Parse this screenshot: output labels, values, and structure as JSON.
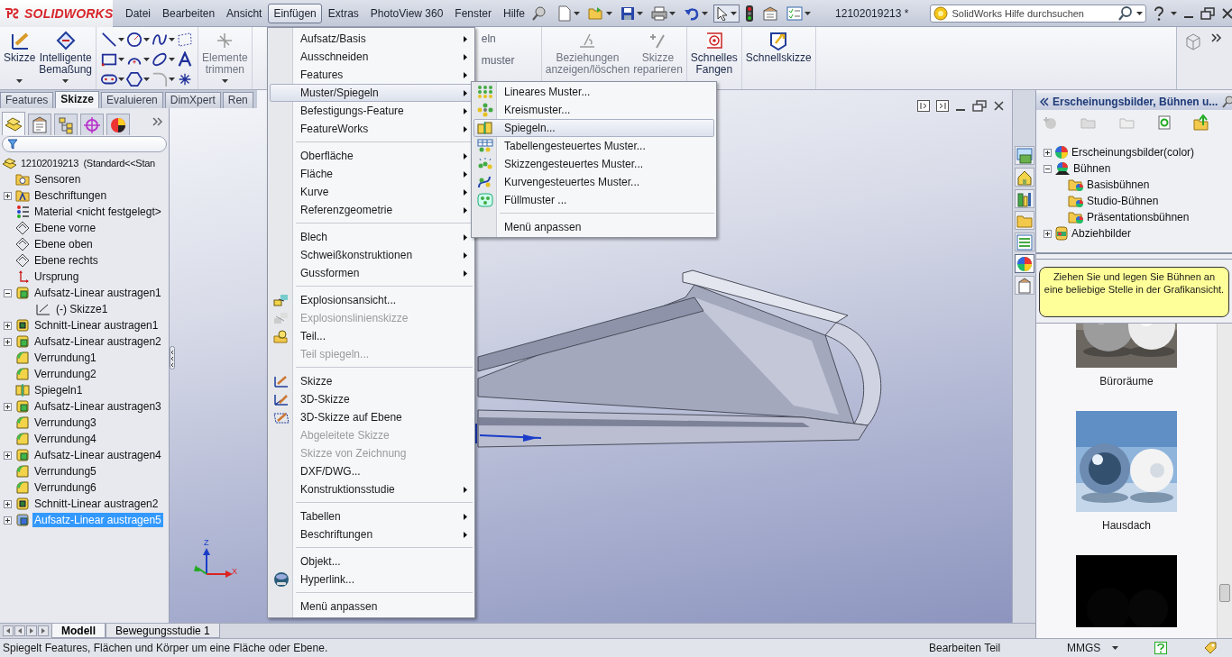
{
  "app_logo": "SOLIDWORKS",
  "menu_bar": [
    {
      "label": "Datei",
      "selected": false
    },
    {
      "label": "Bearbeiten",
      "selected": false
    },
    {
      "label": "Ansicht",
      "selected": false
    },
    {
      "label": "Einfügen",
      "selected": true
    },
    {
      "label": "Extras",
      "selected": false
    },
    {
      "label": "PhotoView 360",
      "selected": false
    },
    {
      "label": "Fenster",
      "selected": false
    },
    {
      "label": "Hilfe",
      "selected": false
    }
  ],
  "document_title": "12102019213 *",
  "help_search": {
    "placeholder": "SolidWorks Hilfe durchsuchen"
  },
  "ribbon": {
    "groups": [
      {
        "kind": "buttons",
        "buttons": [
          {
            "label": "Skizze",
            "disabled": false,
            "dropdown": true
          },
          {
            "label": "Intelligente Bemaßung",
            "disabled": false,
            "dropdown": true
          }
        ]
      },
      {
        "kind": "tools",
        "tools": [
          {
            "kind": "line",
            "disabled": false
          },
          {
            "kind": "circle",
            "disabled": false
          },
          {
            "kind": "spline",
            "disabled": false
          },
          {
            "kind": "construction",
            "disabled": false
          },
          {
            "kind": "rectangle",
            "disabled": false
          },
          {
            "kind": "arc",
            "disabled": false
          },
          {
            "kind": "ellipse",
            "disabled": false
          },
          {
            "kind": "text",
            "disabled": false
          },
          {
            "kind": "slot",
            "disabled": false
          },
          {
            "kind": "polygon",
            "disabled": false
          },
          {
            "kind": "fillet",
            "disabled": true
          },
          {
            "kind": "point",
            "disabled": false
          }
        ]
      },
      {
        "kind": "buttons",
        "buttons": [
          {
            "label": "Elemente trimmen",
            "disabled": true,
            "dropdown": true
          }
        ]
      },
      {
        "kind": "covered",
        "labels": [
          "eln",
          "muster"
        ]
      },
      {
        "kind": "buttons",
        "buttons": [
          {
            "label": "Beziehungen anzeigen/löschen",
            "disabled": true,
            "dropdown": false
          },
          {
            "label": "Skizze reparieren",
            "disabled": true,
            "dropdown": false
          }
        ]
      },
      {
        "kind": "buttons",
        "buttons": [
          {
            "label": "Schnelles Fangen",
            "disabled": false,
            "dropdown": false
          }
        ]
      },
      {
        "kind": "buttons",
        "buttons": [
          {
            "label": "Schnellskizze",
            "disabled": false,
            "dropdown": false
          }
        ]
      }
    ]
  },
  "command_tabs": [
    {
      "label": "Features",
      "selected": false
    },
    {
      "label": "Skizze",
      "selected": true
    },
    {
      "label": "Evaluieren",
      "selected": false
    },
    {
      "label": "DimXpert",
      "selected": false
    },
    {
      "label": "Ren",
      "selected": false
    }
  ],
  "panel_tabs": [
    {
      "kind": "feature_tree",
      "selected": true
    },
    {
      "kind": "properties",
      "selected": false
    },
    {
      "kind": "configurations",
      "selected": false
    },
    {
      "kind": "dimxpert",
      "selected": false
    },
    {
      "kind": "display",
      "selected": false
    }
  ],
  "feature_tree": {
    "root": "12102019213  (Standard<<Stan",
    "items": [
      {
        "label": "Sensoren",
        "kind": "sensors",
        "selected": false
      },
      {
        "label": "Beschriftungen",
        "kind": "annotations",
        "expanded": false,
        "selected": false
      },
      {
        "label": "Material <nicht festgelegt>",
        "kind": "material",
        "selected": false
      },
      {
        "label": "Ebene vorne",
        "kind": "plane",
        "selected": false
      },
      {
        "label": "Ebene oben",
        "kind": "plane",
        "selected": false
      },
      {
        "label": "Ebene rechts",
        "kind": "plane",
        "selected": false
      },
      {
        "label": "Ursprung",
        "kind": "origin",
        "selected": false
      },
      {
        "label": "Aufsatz-Linear austragen1",
        "kind": "boss",
        "expanded": true,
        "selected": false,
        "children": [
          {
            "label": "(-) Skizze1",
            "kind": "sketch",
            "selected": false
          }
        ]
      },
      {
        "label": "Schnitt-Linear austragen1",
        "kind": "cut",
        "expanded": false,
        "selected": false
      },
      {
        "label": "Aufsatz-Linear austragen2",
        "kind": "boss",
        "expanded": false,
        "selected": false
      },
      {
        "label": "Verrundung1",
        "kind": "fillet",
        "selected": false
      },
      {
        "label": "Verrundung2",
        "kind": "fillet",
        "selected": false
      },
      {
        "label": "Spiegeln1",
        "kind": "mirror",
        "selected": false
      },
      {
        "label": "Aufsatz-Linear austragen3",
        "kind": "boss",
        "expanded": false,
        "selected": false
      },
      {
        "label": "Verrundung3",
        "kind": "fillet",
        "selected": false
      },
      {
        "label": "Verrundung4",
        "kind": "fillet",
        "selected": false
      },
      {
        "label": "Aufsatz-Linear austragen4",
        "kind": "boss",
        "expanded": false,
        "selected": false
      },
      {
        "label": "Verrundung5",
        "kind": "fillet",
        "selected": false
      },
      {
        "label": "Verrundung6",
        "kind": "fillet",
        "selected": false
      },
      {
        "label": "Schnitt-Linear austragen2",
        "kind": "cut",
        "expanded": false,
        "selected": false
      },
      {
        "label": "Aufsatz-Linear austragen5",
        "kind": "boss",
        "expanded": false,
        "selected": true
      }
    ]
  },
  "view_triad": {
    "z_label": "Z",
    "x_label": "X"
  },
  "task_pane_tabs": [
    {
      "kind": "resources",
      "selected": false
    },
    {
      "kind": "home",
      "selected": false
    },
    {
      "kind": "library",
      "selected": false
    },
    {
      "kind": "explorer",
      "selected": false
    },
    {
      "kind": "palette",
      "selected": false
    },
    {
      "kind": "appearances",
      "selected": true
    },
    {
      "kind": "properties",
      "selected": false
    }
  ],
  "appearance_panel": {
    "title": "Erscheinungsbilder, Bühnen u...",
    "tree": [
      {
        "label": "Erscheinungsbilder(color)",
        "kind": "appearances",
        "expanded": false
      },
      {
        "label": "Bühnen",
        "kind": "scenes",
        "expanded": true,
        "children": [
          {
            "label": "Basisbühnen"
          },
          {
            "label": "Studio-Bühnen"
          },
          {
            "label": "Präsentationsbühnen"
          }
        ]
      },
      {
        "label": "Abziehbilder",
        "kind": "decals",
        "expanded": false
      }
    ],
    "hint": "Ziehen Sie und legen Sie Bühnen an eine beliebige Stelle in der Grafikansicht.",
    "thumbnails": [
      {
        "kind": "picture",
        "label": "Büroräume"
      },
      {
        "kind": "picture",
        "label": "Hausdach"
      },
      {
        "kind": "picture"
      }
    ]
  },
  "bottom_tabs": [
    {
      "label": "Modell",
      "selected": true
    },
    {
      "label": "Bewegungsstudie 1",
      "selected": false
    }
  ],
  "status_bar": {
    "message": "Spiegelt Features, Flächen und Körper um eine Fläche oder Ebene.",
    "mode": "Bearbeiten Teil",
    "units": "MMGS"
  },
  "insert_menu": {
    "groups": [
      [
        {
          "label": "Aufsatz/Basis",
          "kind": "plain",
          "submenu": true,
          "disabled": false,
          "selected": false
        },
        {
          "label": "Ausschneiden",
          "kind": "plain",
          "submenu": true,
          "disabled": false,
          "selected": false
        },
        {
          "label": "Features",
          "kind": "plain",
          "submenu": true,
          "disabled": false,
          "selected": false
        },
        {
          "label": "Muster/Spiegeln",
          "kind": "plain",
          "submenu": true,
          "disabled": false,
          "selected": true
        },
        {
          "label": "Befestigungs-Feature",
          "kind": "plain",
          "submenu": true,
          "disabled": false,
          "selected": false
        },
        {
          "label": "FeatureWorks",
          "kind": "plain",
          "submenu": true,
          "disabled": false,
          "selected": false
        }
      ],
      [
        {
          "label": "Oberfläche",
          "kind": "plain",
          "submenu": true,
          "disabled": false,
          "selected": false
        },
        {
          "label": "Fläche",
          "kind": "plain",
          "submenu": true,
          "disabled": false,
          "selected": false
        },
        {
          "label": "Kurve",
          "kind": "plain",
          "submenu": true,
          "disabled": false,
          "selected": false
        },
        {
          "label": "Referenzgeometrie",
          "kind": "plain",
          "submenu": true,
          "disabled": false,
          "selected": false
        }
      ],
      [
        {
          "label": "Blech",
          "kind": "plain",
          "submenu": true,
          "disabled": false,
          "selected": false
        },
        {
          "label": "Schweißkonstruktionen",
          "kind": "plain",
          "submenu": true,
          "disabled": false,
          "selected": false
        },
        {
          "label": "Gussformen",
          "kind": "plain",
          "submenu": true,
          "disabled": false,
          "selected": false
        }
      ],
      [
        {
          "label": "Explosionsansicht...",
          "kind": "explode",
          "submenu": false,
          "disabled": false,
          "selected": false
        },
        {
          "label": "Explosionslinienskizze",
          "kind": "explode_sketch",
          "submenu": false,
          "disabled": true,
          "selected": false
        },
        {
          "label": "Teil...",
          "kind": "part",
          "submenu": false,
          "disabled": false,
          "selected": false
        },
        {
          "label": "Teil spiegeln...",
          "kind": "plain",
          "submenu": false,
          "disabled": true,
          "selected": false
        }
      ],
      [
        {
          "label": "Skizze",
          "kind": "sketch",
          "submenu": false,
          "disabled": false,
          "selected": false
        },
        {
          "label": "3D-Skizze",
          "kind": "sketch3d",
          "submenu": false,
          "disabled": false,
          "selected": false
        },
        {
          "label": "3D-Skizze auf Ebene",
          "kind": "sketch_plane",
          "submenu": false,
          "disabled": false,
          "selected": false
        },
        {
          "label": "Abgeleitete Skizze",
          "kind": "plain",
          "submenu": false,
          "disabled": true,
          "selected": false
        },
        {
          "label": "Skizze von Zeichnung",
          "kind": "plain",
          "submenu": false,
          "disabled": true,
          "selected": false
        },
        {
          "label": "DXF/DWG...",
          "kind": "plain",
          "submenu": false,
          "disabled": false,
          "selected": false
        },
        {
          "label": "Konstruktionsstudie",
          "kind": "plain",
          "submenu": true,
          "disabled": false,
          "selected": false
        }
      ],
      [
        {
          "label": "Tabellen",
          "kind": "plain",
          "submenu": true,
          "disabled": false,
          "selected": false
        },
        {
          "label": "Beschriftungen",
          "kind": "plain",
          "submenu": true,
          "disabled": false,
          "selected": false
        }
      ],
      [
        {
          "label": "Objekt...",
          "kind": "plain",
          "submenu": false,
          "disabled": false,
          "selected": false
        },
        {
          "label": "Hyperlink...",
          "kind": "hyperlink",
          "submenu": false,
          "disabled": false,
          "selected": false
        }
      ],
      [
        {
          "label": "Menü anpassen",
          "kind": "plain",
          "submenu": false,
          "disabled": false,
          "selected": false
        }
      ]
    ]
  },
  "pattern_submenu": {
    "groups": [
      [
        {
          "label": "Lineares Muster...",
          "kind": "linear",
          "selected": false
        },
        {
          "label": "Kreismuster...",
          "kind": "circular",
          "selected": false
        },
        {
          "label": "Spiegeln...",
          "kind": "mirror",
          "selected": true
        },
        {
          "label": "Tabellengesteuertes Muster...",
          "kind": "table",
          "selected": false
        },
        {
          "label": "Skizzengesteuertes Muster...",
          "kind": "sketch_driven",
          "selected": false
        },
        {
          "label": "Kurvengesteuertes Muster...",
          "kind": "curve_driven",
          "selected": false
        },
        {
          "label": "Füllmuster ...",
          "kind": "fill",
          "selected": false
        }
      ],
      [
        {
          "label": "Menü anpassen",
          "kind": "plain",
          "selected": false
        }
      ]
    ]
  }
}
